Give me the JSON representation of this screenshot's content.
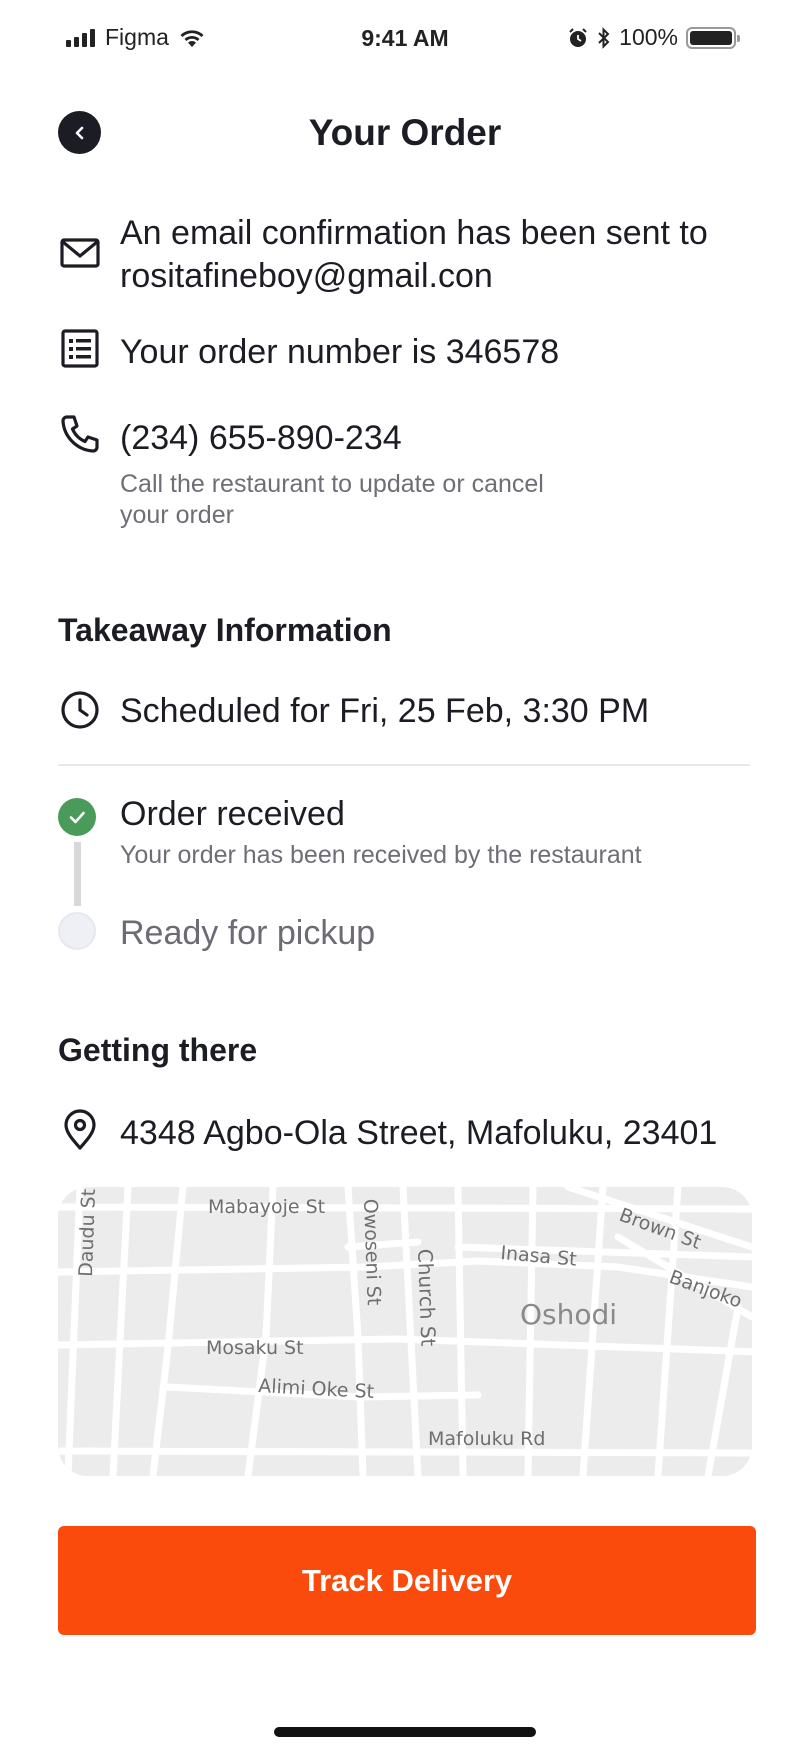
{
  "status_bar": {
    "carrier": "Figma",
    "time": "9:41 AM",
    "battery": "100%"
  },
  "header": {
    "title": "Your Order",
    "back_icon": "chevron-left-icon"
  },
  "confirmation": {
    "email_line1": "An email confirmation has been sent to",
    "email_line2": "rositafineboy@gmail.con",
    "order_number": "Your order number is 346578",
    "phone": "(234) 655-890-234",
    "phone_note_line1": "Call the restaurant to update or cancel",
    "phone_note_line2": "your order"
  },
  "takeaway": {
    "title": "Takeaway Information",
    "scheduled": "Scheduled for Fri, 25 Feb, 3:30 PM",
    "steps": [
      {
        "label": "Order received",
        "detail": "Your order has been received by the restaurant",
        "status": "done"
      },
      {
        "label": "Ready for pickup",
        "detail": "",
        "status": "pending"
      }
    ]
  },
  "getting_there": {
    "title": "Getting there",
    "address": "4348 Agbo-Ola Street, Mafoluku, 23401",
    "map_labels": {
      "mabayoje": "Mabayoje St",
      "daudu": "Daudu St",
      "owoseni": "Owoseni St",
      "church": "Church St",
      "inasa": "Inasa St",
      "brown": "Brown St",
      "banjoko": "Banjoko",
      "oshodi": "Oshodi",
      "mosaku": "Mosaku St",
      "alimi": "Alimi Oke St",
      "mafoluku": "Mafoluku Rd"
    }
  },
  "cta": {
    "label": "Track Delivery"
  },
  "colors": {
    "accent": "#FA4A0C",
    "success": "#4A9A5A",
    "text": "#1C1C24",
    "muted": "#6E6E76"
  }
}
